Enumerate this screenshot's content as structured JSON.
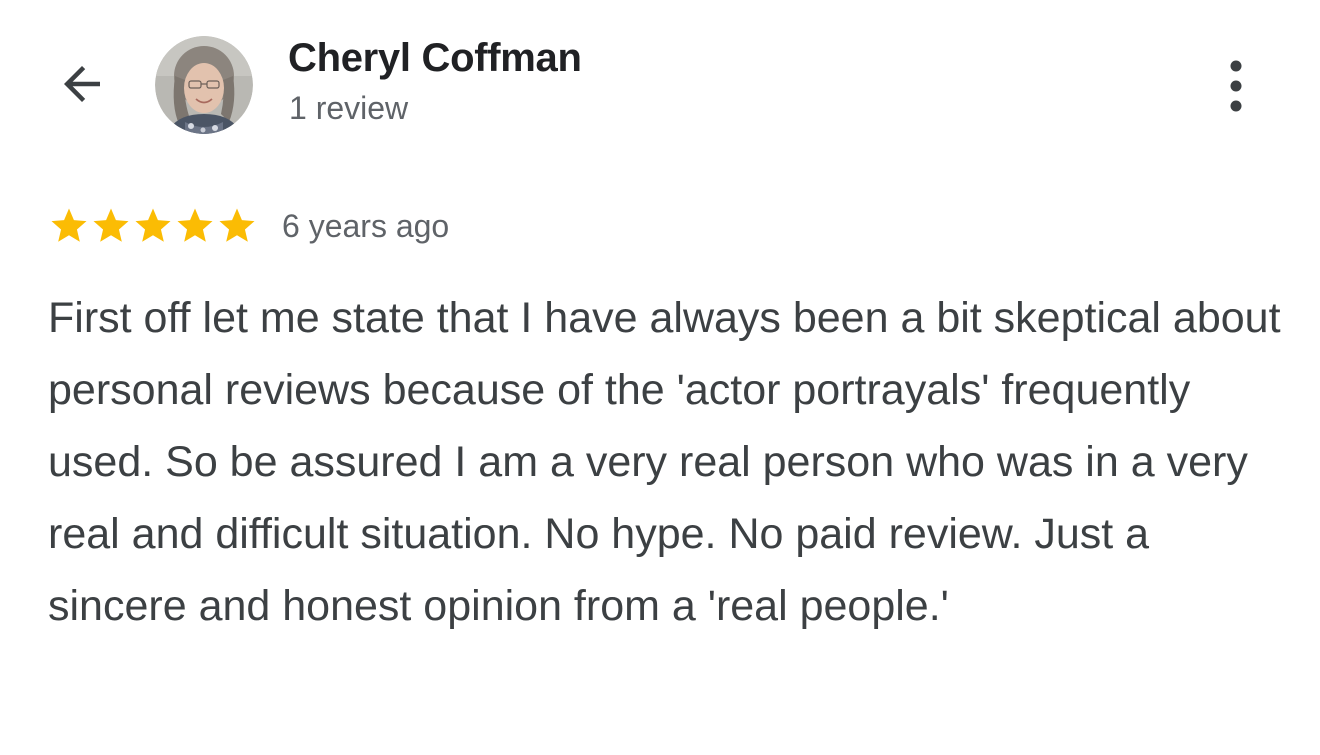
{
  "header": {
    "back_icon": "arrow-back-icon",
    "author_name": "Cheryl Coffman",
    "review_count": "1 review",
    "more_icon": "more-vert-icon"
  },
  "review": {
    "rating": 5,
    "rating_max": 5,
    "star_color": "#fbbc04",
    "timestamp": "6 years ago",
    "text": "First off let me state that I have always been a bit skeptical about personal reviews because of the 'actor portrayals' frequently used. So be assured I am a very real person who was in a very real and difficult situation. No hype. No paid review. Just a sincere and honest opinion from a 'real people.'"
  }
}
